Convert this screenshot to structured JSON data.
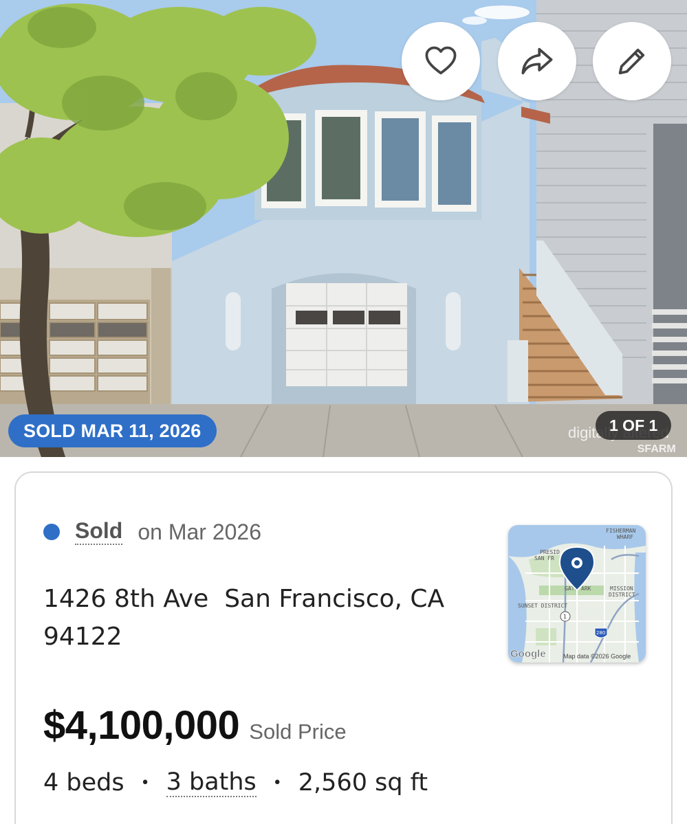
{
  "photo": {
    "badge": "SOLD MAR 11, 2026",
    "counter": "1 OF 1",
    "watermark": "digitally altered",
    "watermark_brand": "SFARM"
  },
  "actions": {
    "favorite_icon": "heart-icon",
    "share_icon": "share-icon",
    "edit_icon": "pencil-icon"
  },
  "status": {
    "label": "Sold",
    "date": "on Mar 2026",
    "color": "#2f6fc7"
  },
  "address": {
    "street": "1426 8th Ave",
    "city_state": "San Francisco, CA",
    "zip": "94122"
  },
  "map": {
    "labels": [
      "FISHERMAN",
      "WHARF",
      "PRESID",
      "SAN FR",
      "GATE",
      "ARK",
      "MISSION",
      "DISTRICT",
      "SUNSET DISTRICT",
      "1",
      "280"
    ],
    "logo": "Google",
    "attribution": "Map data ©2026 Google"
  },
  "price": {
    "amount": "$4,100,000",
    "label": "Sold Price"
  },
  "facts": {
    "beds": "4 beds",
    "baths": "3 baths",
    "sqft": "2,560 sq ft",
    "separator": "•"
  }
}
